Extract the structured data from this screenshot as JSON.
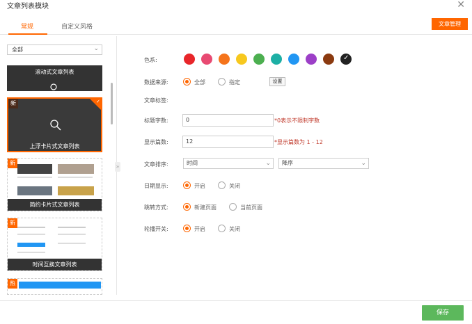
{
  "dialog": {
    "title": "文章列表模块"
  },
  "tabs": [
    {
      "label": "常规"
    },
    {
      "label": "自定义风格"
    }
  ],
  "header": {
    "manage_label": "文章管理"
  },
  "left": {
    "filter_value": "全部",
    "cards": [
      {
        "label": "滚动式文章列表"
      },
      {
        "label": "上浮卡片式文章列表",
        "badge": "新"
      },
      {
        "label": "简约卡片式文章列表",
        "badge": "新"
      },
      {
        "label": "时间互换文章列表",
        "badge": "新"
      },
      {
        "badge": "热"
      }
    ]
  },
  "form": {
    "color_label": "色系:",
    "colors": [
      "#e8262a",
      "#e84a72",
      "#f5741b",
      "#f7c81e",
      "#4caf50",
      "#1dafa5",
      "#2196f3",
      "#9c3fc7",
      "#8b3a10",
      "#222222"
    ],
    "source_label": "数据来源:",
    "source_all": "全部",
    "source_specified": "指定",
    "settings_label": "设置",
    "tags_label": "文章标签:",
    "title_chars_label": "标题字数:",
    "title_chars_value": "0",
    "title_chars_hint": "*0表示不限制字数",
    "count_label": "显示篇数:",
    "count_value": "12",
    "count_hint": "*显示篇数为 1 - 12",
    "sort_label": "文章排序:",
    "sort_field": "时间",
    "sort_order": "降序",
    "date_label": "日期显示:",
    "date_on": "开启",
    "date_off": "关闭",
    "jump_label": "跳转方式:",
    "jump_new": "新建页面",
    "jump_current": "当前页面",
    "carousel_label": "轮播开关:",
    "carousel_on": "开启",
    "carousel_off": "关闭"
  },
  "footer": {
    "save_label": "保存"
  }
}
